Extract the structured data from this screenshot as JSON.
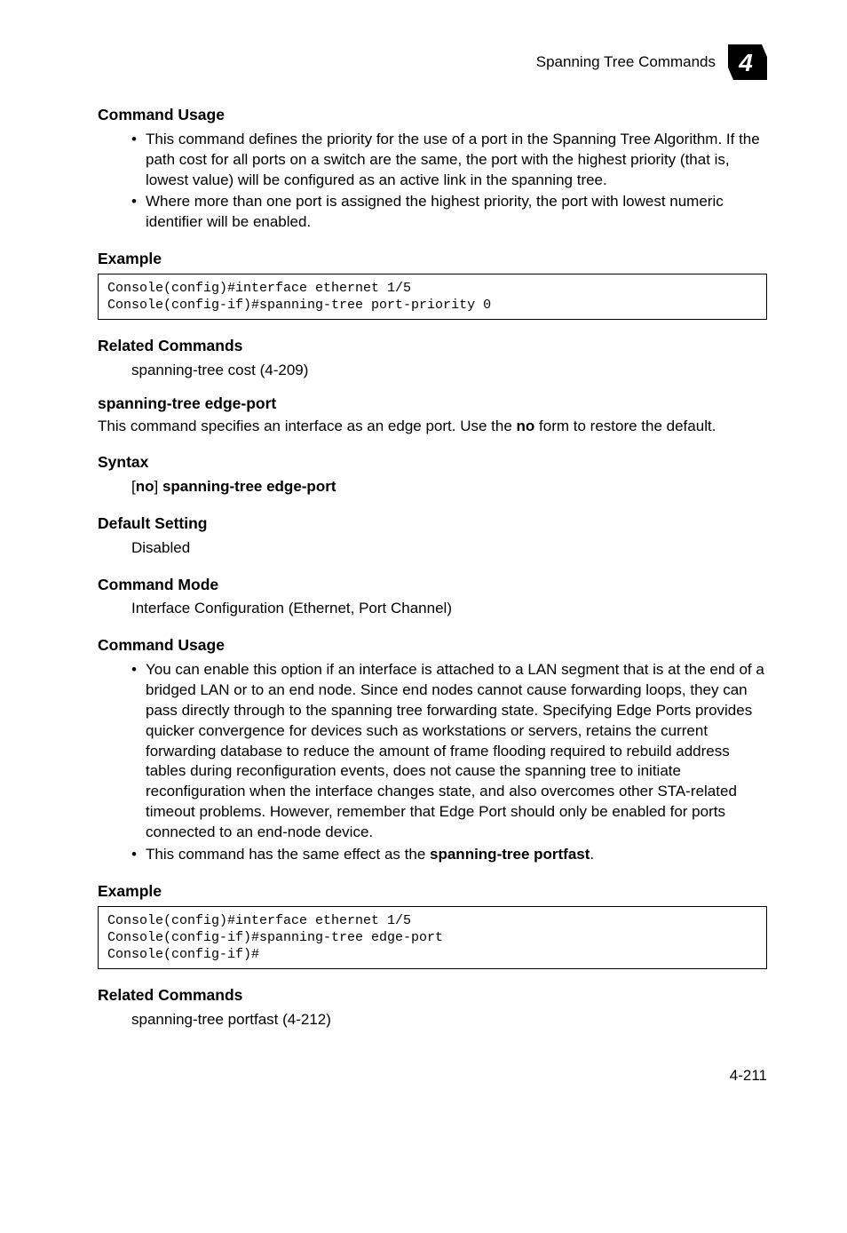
{
  "header": {
    "section_title": "Spanning Tree Commands",
    "chapter_number": "4"
  },
  "sections": [
    {
      "heading_key": "cmd_usage1",
      "heading": "Command Usage",
      "bullets": [
        "This command defines the priority for the use of a port in the Spanning Tree Algorithm. If the path cost for all ports on a switch are the same, the port with the highest priority (that is, lowest value) will be configured as an active link in the spanning tree.",
        "Where more than one port is assigned the highest priority, the port with lowest numeric identifier will be enabled."
      ]
    }
  ],
  "example1": {
    "heading": "Example",
    "code": "Console(config)#interface ethernet 1/5\nConsole(config-if)#spanning-tree port-priority 0"
  },
  "related1": {
    "heading": "Related Commands",
    "text": "spanning-tree cost (4-209)"
  },
  "edgeport": {
    "heading": "spanning-tree edge-port",
    "desc_prefix": "This command specifies an interface as an edge port. Use the ",
    "desc_bold": "no",
    "desc_suffix": " form to restore the default."
  },
  "syntax": {
    "heading": "Syntax",
    "prefix": "[",
    "bold1": "no",
    "mid": "] ",
    "bold2": "spanning-tree edge-port"
  },
  "default_setting": {
    "heading": "Default Setting",
    "text": "Disabled"
  },
  "cmd_mode": {
    "heading": "Command Mode",
    "text": "Interface Configuration (Ethernet, Port Channel)"
  },
  "cmd_usage2": {
    "heading": "Command Usage",
    "bullets": [
      "You can enable this option if an interface is attached to a LAN segment that is at the end of a bridged LAN or to an end node. Since end nodes cannot cause forwarding loops, they can pass directly through to the spanning tree forwarding state. Specifying Edge Ports provides quicker convergence for devices such as workstations or servers, retains the current forwarding database to reduce the amount of frame flooding required to rebuild address tables during reconfiguration events, does not cause the spanning tree to initiate reconfiguration when the interface changes state, and also overcomes other STA-related timeout problems. However, remember that Edge Port should only be enabled for ports connected to an end-node device."
    ],
    "bullet2_prefix": "This command has the same effect as the ",
    "bullet2_bold": "spanning-tree portfast",
    "bullet2_suffix": "."
  },
  "example2": {
    "heading": "Example",
    "code": "Console(config)#interface ethernet 1/5\nConsole(config-if)#spanning-tree edge-port\nConsole(config-if)#"
  },
  "related2": {
    "heading": "Related Commands",
    "text": "spanning-tree portfast (4-212)"
  },
  "footer": {
    "page": "4-211"
  }
}
